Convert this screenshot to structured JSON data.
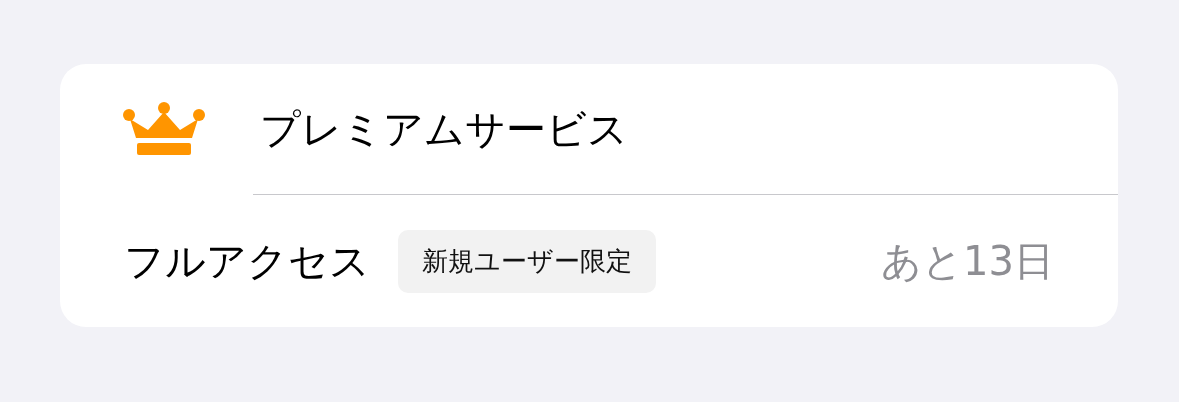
{
  "header": {
    "title": "プレミアムサービス"
  },
  "plan": {
    "name": "フルアクセス",
    "badge": "新規ユーザー限定",
    "remaining": "あと13日"
  }
}
